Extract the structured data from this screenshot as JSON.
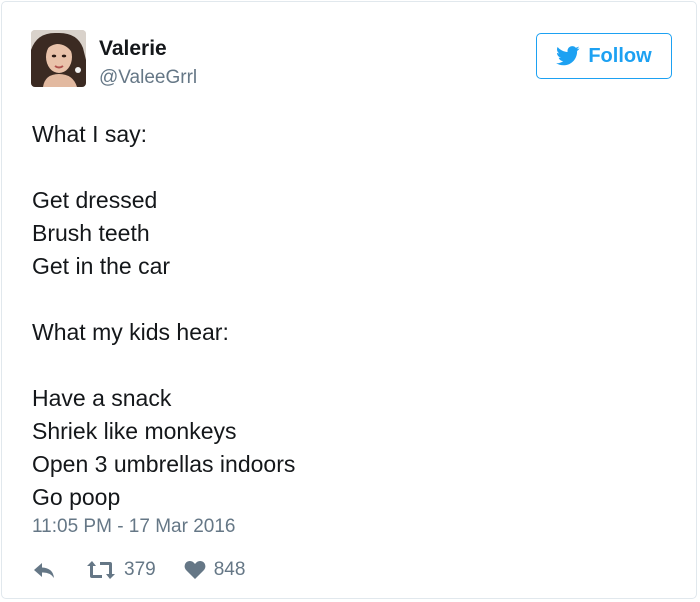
{
  "user": {
    "display_name": "Valerie",
    "handle": "@ValeeGrrl",
    "avatar_icon": "profile-photo"
  },
  "follow_button": {
    "label": "Follow",
    "icon": "twitter-bird-icon",
    "color": "#1da1f2"
  },
  "tweet": {
    "lines": [
      "What I say:",
      "",
      "Get dressed",
      "Brush teeth",
      "Get in the car",
      "",
      "What my kids hear:",
      "",
      "Have a snack",
      "Shriek like monkeys",
      "Open 3 umbrellas indoors",
      "Go poop"
    ],
    "timestamp": "11:05 PM - 17 Mar 2016"
  },
  "actions": {
    "reply_icon": "reply-icon",
    "retweet_icon": "retweet-icon",
    "retweet_count": "379",
    "like_icon": "heart-icon",
    "like_count": "848"
  },
  "colors": {
    "text": "#14171a",
    "secondary": "#657786",
    "border": "#e1e8ed"
  }
}
